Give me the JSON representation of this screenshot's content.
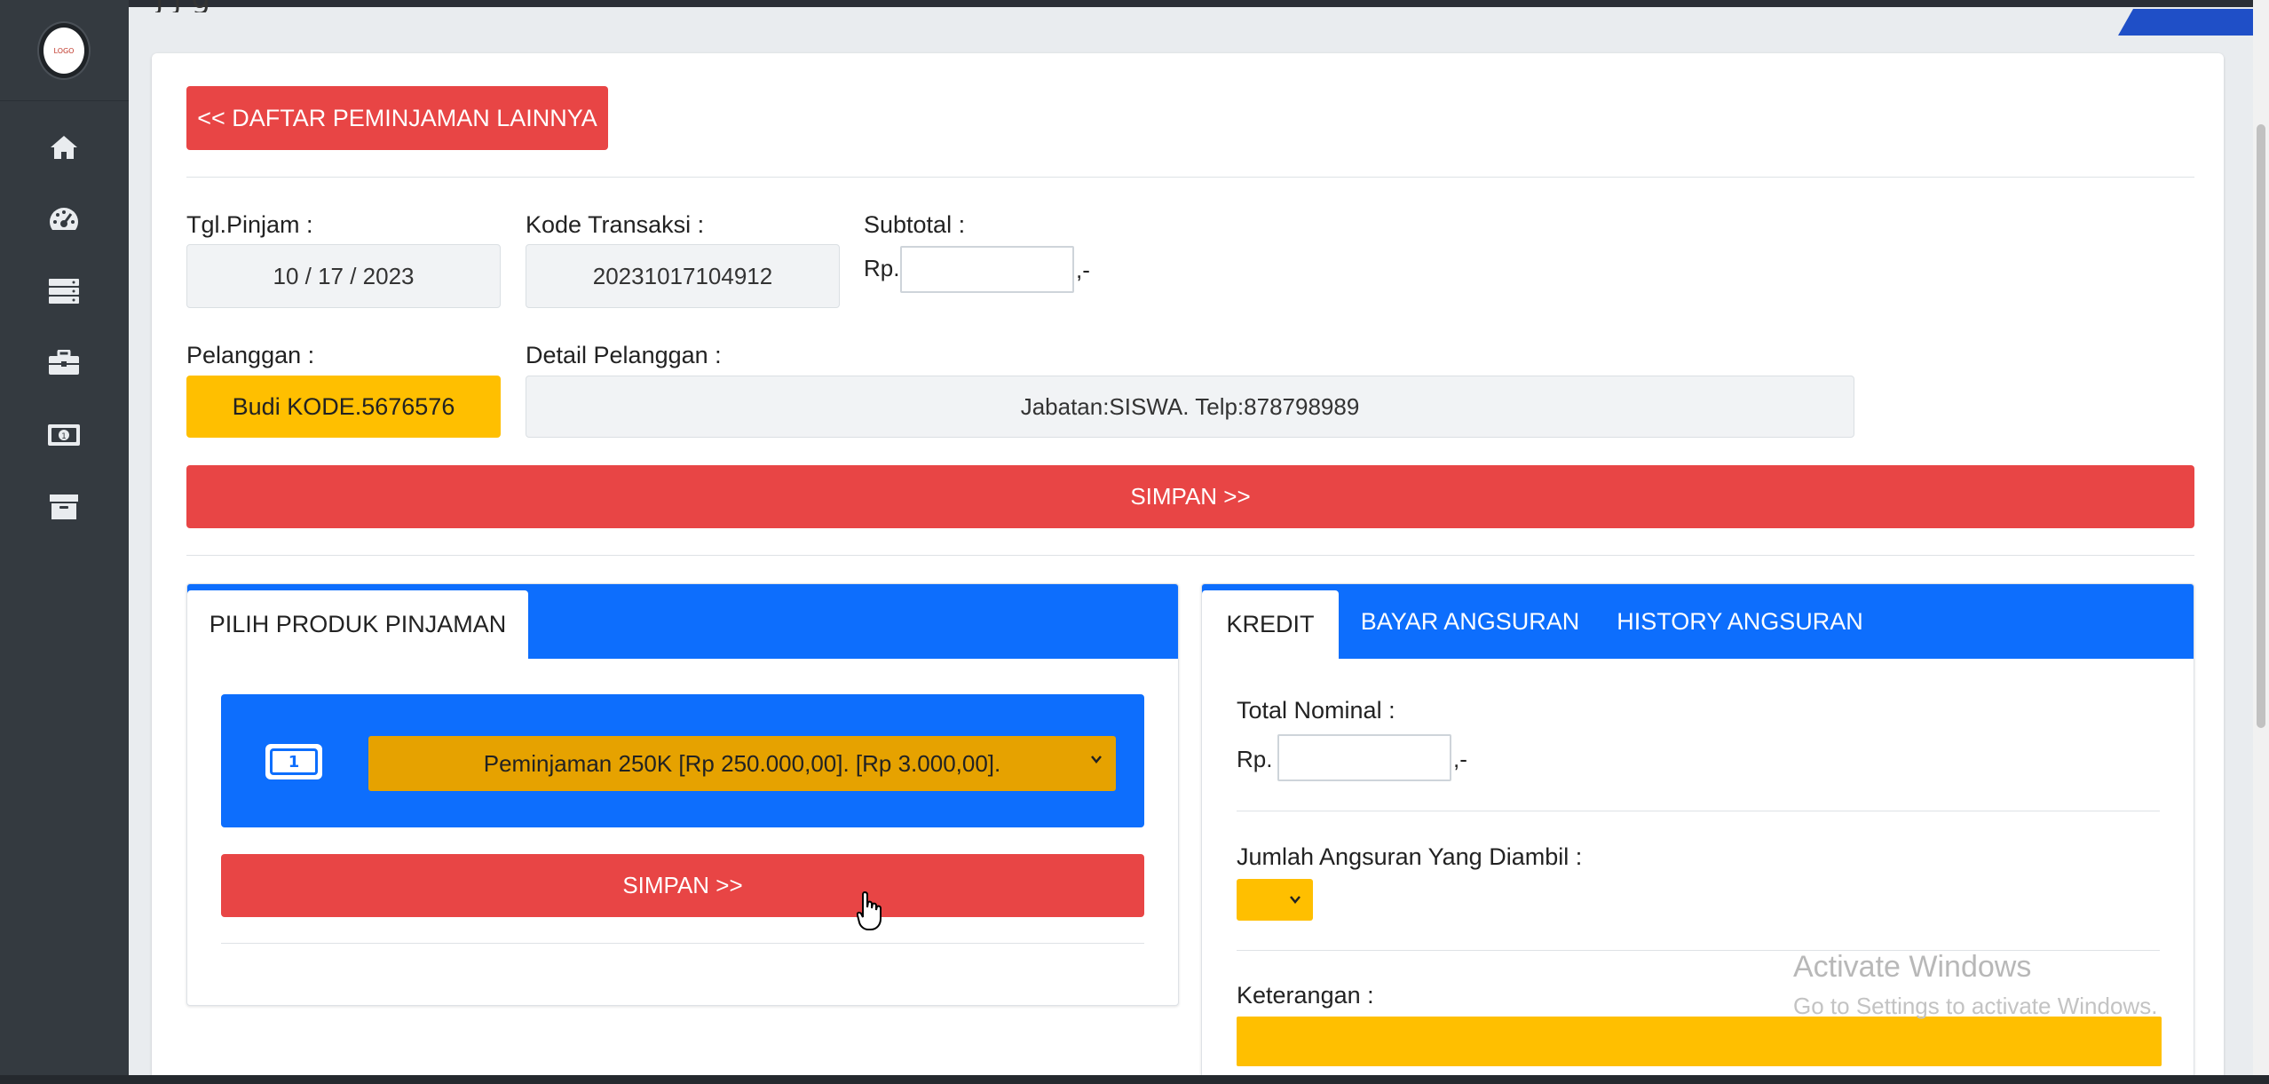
{
  "page": {
    "title_fragment": "j   j g"
  },
  "sidebar": {
    "logo_text": "LOGO",
    "items": [
      {
        "icon": "home-icon"
      },
      {
        "icon": "speedometer-icon"
      },
      {
        "icon": "server-icon"
      },
      {
        "icon": "briefcase-icon"
      },
      {
        "icon": "money-icon"
      },
      {
        "icon": "archive-icon"
      }
    ]
  },
  "header": {
    "back_button": "<< DAFTAR PEMINJAMAN LAINNYA"
  },
  "form": {
    "tgl_label": "Tgl.Pinjam :",
    "tgl_value": "10 / 17 / 2023",
    "kode_label": "Kode Transaksi :",
    "kode_value": "20231017104912",
    "subtotal_label": "Subtotal :",
    "rp_prefix": "Rp.",
    "rp_suffix": ",-",
    "pelanggan_label": "Pelanggan :",
    "pelanggan_value": "Budi KODE.5676576",
    "detail_label": "Detail Pelanggan :",
    "detail_value": "Jabatan:SISWA. Telp:878798989",
    "simpan_label": "SIMPAN >>"
  },
  "left_panel": {
    "tab_label": "PILIH PRODUK PINJAMAN",
    "product_selected": "Peminjaman 250K [Rp 250.000,00]. [Rp 3.000,00].",
    "simpan_label": "SIMPAN >>"
  },
  "right_panel": {
    "tabs": [
      "KREDIT",
      "BAYAR ANGSURAN",
      "HISTORY ANGSURAN"
    ],
    "total_label": "Total Nominal :",
    "rp_prefix": "Rp.",
    "rp_suffix": ",-",
    "jumlah_label": "Jumlah Angsuran Yang Diambil :",
    "keterangan_label": "Keterangan :"
  },
  "watermark": {
    "line1": "Activate Windows",
    "line2": "Go to Settings to activate Windows."
  },
  "colors": {
    "red": "#e84545",
    "blue": "#0d6efd",
    "yellow": "#ffbf00",
    "sidebar": "#343a40"
  }
}
